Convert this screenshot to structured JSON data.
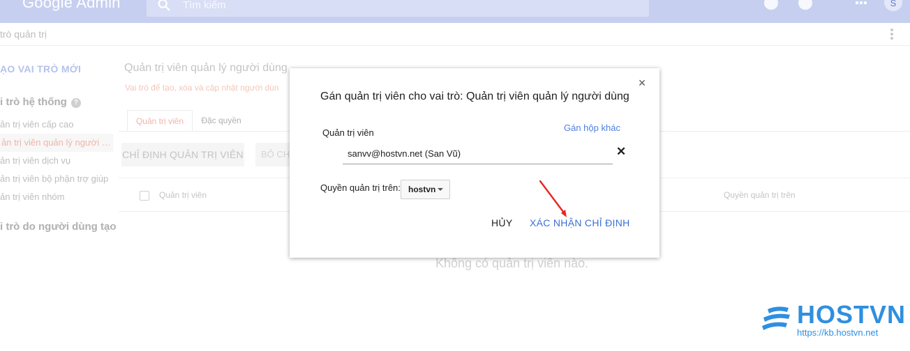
{
  "topbar": {
    "logo_text": "Google Admin",
    "search_placeholder": "Tìm kiếm",
    "avatar_letter": "S",
    "icons": [
      "search-icon",
      "notifications-icon",
      "help-icon",
      "apps-icon"
    ]
  },
  "subheader": {
    "breadcrumb": "trò quản trị"
  },
  "sidebar": {
    "create_role": "ẠO VAI TRÒ MỚI",
    "system_roles_heading": "i trò hệ thống",
    "items": [
      "ản trị viên cấp cao",
      "ản trị viên quản lý người d...",
      "ản trị viên dịch vụ",
      "ản trị viên bộ phận trợ giúp",
      "ản trị viên nhóm"
    ],
    "custom_roles_heading": "i trò do người dùng tạo"
  },
  "main": {
    "title": "Quản trị viên quản lý người dùng",
    "description": "Vai trò để tạo, xóa và cập nhật người dùn",
    "tabs": [
      "Quản trị viên",
      "Đặc quyền"
    ],
    "assign_button": "CHỈ ĐỊNH QUẢN TRỊ VIÊN",
    "remove_button": "BỎ CH",
    "columns": [
      "Quản trị viên",
      "Quyền quản trị trên"
    ],
    "empty_message": "Không có quản trị viên nào."
  },
  "dialog": {
    "title": "Gán quản trị viên cho vai trò: Quản trị viên quản lý người dùng",
    "admin_label": "Quản trị viên",
    "assign_other_link": "Gán hộp khác",
    "admin_value": "sanvv@hostvn.net (San Vũ)",
    "clear_symbol": "✕",
    "scope_label": "Quyền quản trị trên:",
    "scope_value": "hostvn",
    "cancel_button": "HỦY",
    "confirm_button": "XÁC NHẬN CHỈ ĐỊNH"
  },
  "annotation": {
    "arrow_color": "#e8261f"
  },
  "watermark": {
    "brand": "HOSTVN",
    "url": "https://kb.hostvn.net",
    "color": "#2f8fe0"
  }
}
